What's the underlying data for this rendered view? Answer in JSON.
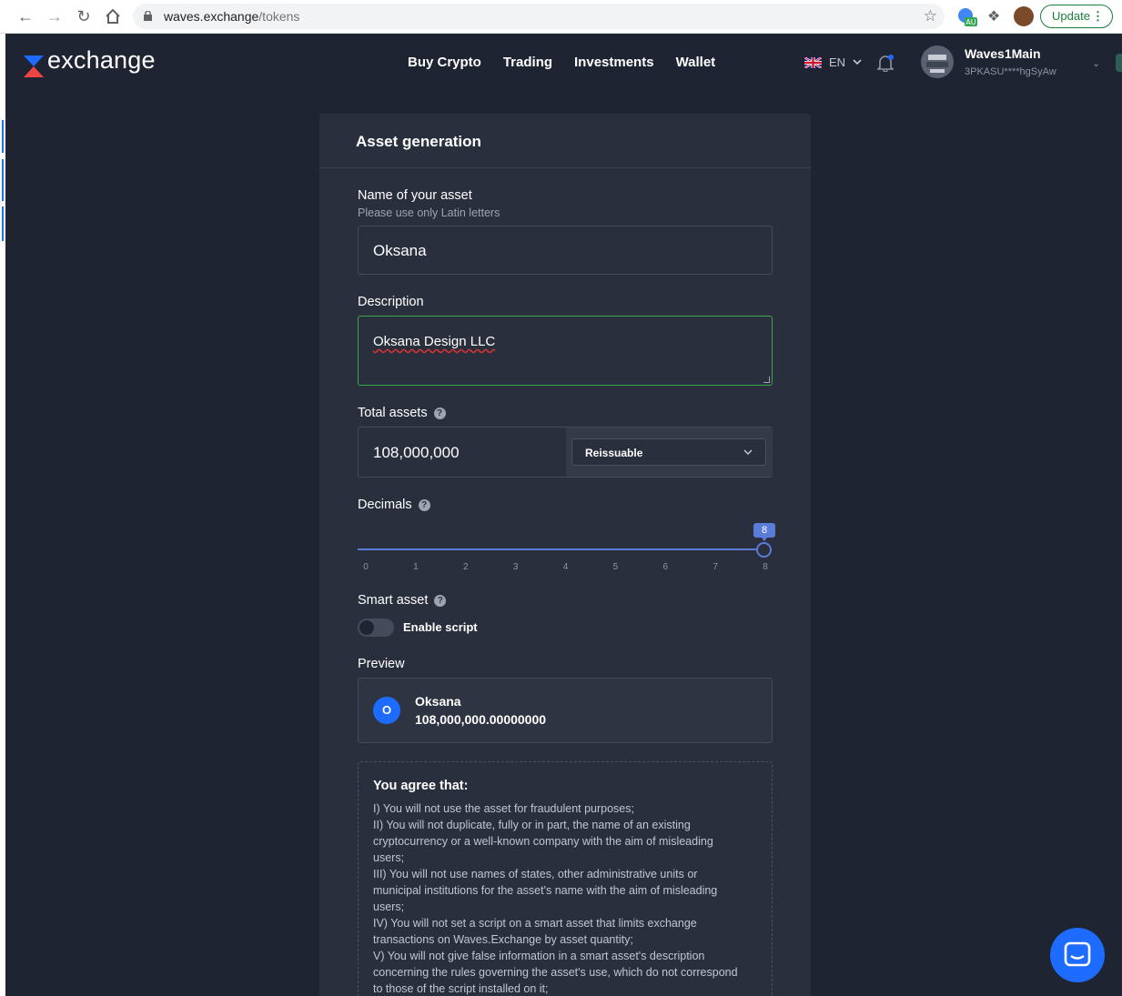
{
  "browser": {
    "url_host": "waves.exchange",
    "url_path": "/tokens",
    "update_label": "Update"
  },
  "header": {
    "logo_text": "exchange",
    "nav": [
      "Buy Crypto",
      "Trading",
      "Investments",
      "Wallet"
    ],
    "language": "EN",
    "user_name": "Waves1Main",
    "user_address": "3PKASU****hgSyAw"
  },
  "form": {
    "title": "Asset generation",
    "name_label": "Name of your asset",
    "name_hint": "Please use only Latin letters",
    "name_value": "Oksana",
    "description_label": "Description",
    "description_value": "Oksana Design LLC",
    "total_label": "Total assets",
    "total_value": "108,000,000",
    "reissuable_option": "Reissuable",
    "decimals_label": "Decimals",
    "decimals_value": "8",
    "decimals_ticks": [
      "0",
      "1",
      "2",
      "3",
      "4",
      "5",
      "6",
      "7",
      "8"
    ],
    "smart_label": "Smart asset",
    "enable_script_label": "Enable script",
    "enable_script_on": false,
    "preview_label": "Preview",
    "preview_badge": "O",
    "preview_name": "Oksana",
    "preview_amount": "108,000,000.00000000"
  },
  "agreement": {
    "title": "You agree that:",
    "lines": [
      "I) You will not use the asset for fraudulent purposes;",
      "II) You will not duplicate, fully or in part, the name of an existing",
      "cryptocurrency or a well-known company with the aim of misleading",
      "users;",
      "III) You will not use names of states, other administrative units or",
      "municipal institutions for the asset's name with the aim of misleading",
      "users;",
      "IV) You will not set a script on a smart asset that limits exchange",
      "transactions on Waves.Exchange by asset quantity;",
      "V) You will not give false information in a smart asset's description",
      "concerning the rules governing the asset's use, which do not correspond",
      "to those of the script installed on it;"
    ]
  },
  "colors": {
    "background": "#1f2432",
    "card": "#2a2f3d",
    "accent_blue": "#1e6bff",
    "slider_blue": "#5a7bd8",
    "focus_green": "#3aa74c"
  }
}
